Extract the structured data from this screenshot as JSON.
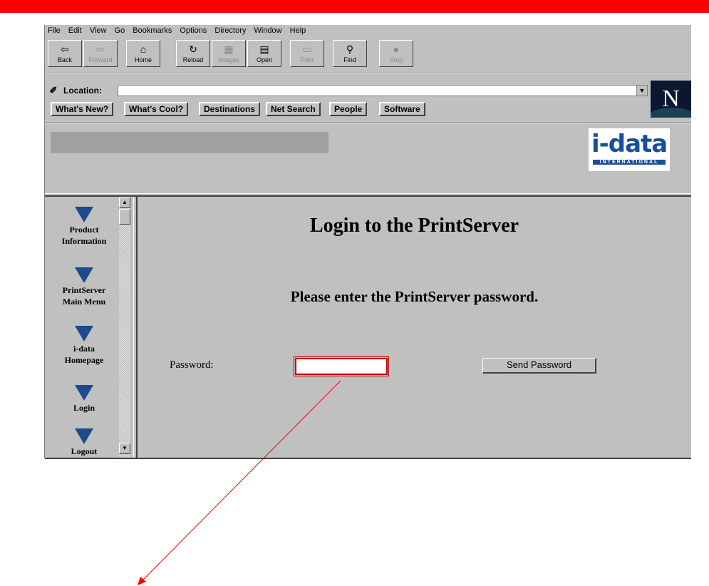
{
  "menu": [
    "File",
    "Edit",
    "View",
    "Go",
    "Bookmarks",
    "Options",
    "Directory",
    "Window",
    "Help"
  ],
  "toolbar": {
    "back": "Back",
    "forward": "Forward",
    "home": "Home",
    "reload": "Reload",
    "images": "Images",
    "open": "Open",
    "print": "Print",
    "find": "Find",
    "stop": "Stop"
  },
  "location": {
    "label": "Location:",
    "value": ""
  },
  "directory_buttons": [
    "What's New?",
    "What's Cool?",
    "Destinations",
    "Net Search",
    "People",
    "Software"
  ],
  "logo": {
    "brand": "i-data",
    "sub": "INTERNATIONAL",
    "netscape": "N"
  },
  "nav": [
    {
      "label1": "Product",
      "label2": "Information"
    },
    {
      "label1": "PrintServer",
      "label2": "Main Menu"
    },
    {
      "label1": "i-data",
      "label2": "Homepage"
    },
    {
      "label1": "Login",
      "label2": ""
    },
    {
      "label1": "Logout",
      "label2": ""
    }
  ],
  "content": {
    "title": "Login to the PrintServer",
    "subtitle": "Please enter the PrintServer password.",
    "password_label": "Password:",
    "password_value": "",
    "send_button": "Send Password"
  },
  "colors": {
    "topbar": "#ff0000",
    "highlight": "#c00000",
    "arrow": "#ff0000",
    "chrome": "#c0c0c0"
  }
}
